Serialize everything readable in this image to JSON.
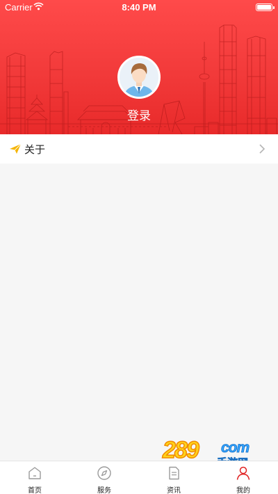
{
  "status_bar": {
    "carrier": "Carrier",
    "time": "8:40 PM",
    "wifi_icon": "wifi-icon",
    "battery_icon": "battery-icon"
  },
  "header": {
    "background_color": "#f23a3a",
    "avatar_icon": "user-avatar",
    "login_label": "登录"
  },
  "menu": {
    "items": [
      {
        "label": "关于",
        "icon": "paper-plane-icon",
        "accessory": "chevron-right-icon",
        "icon_color": "#f5b400"
      }
    ]
  },
  "watermark": {
    "number": "289",
    "domain": "com",
    "subtitle": "手游网"
  },
  "tabbar": {
    "active_color": "#e02020",
    "tabs": [
      {
        "label": "首页",
        "icon": "home-icon",
        "active": false
      },
      {
        "label": "服务",
        "icon": "compass-icon",
        "active": false
      },
      {
        "label": "资讯",
        "icon": "document-icon",
        "active": false
      },
      {
        "label": "我的",
        "icon": "person-icon",
        "active": true
      }
    ]
  }
}
